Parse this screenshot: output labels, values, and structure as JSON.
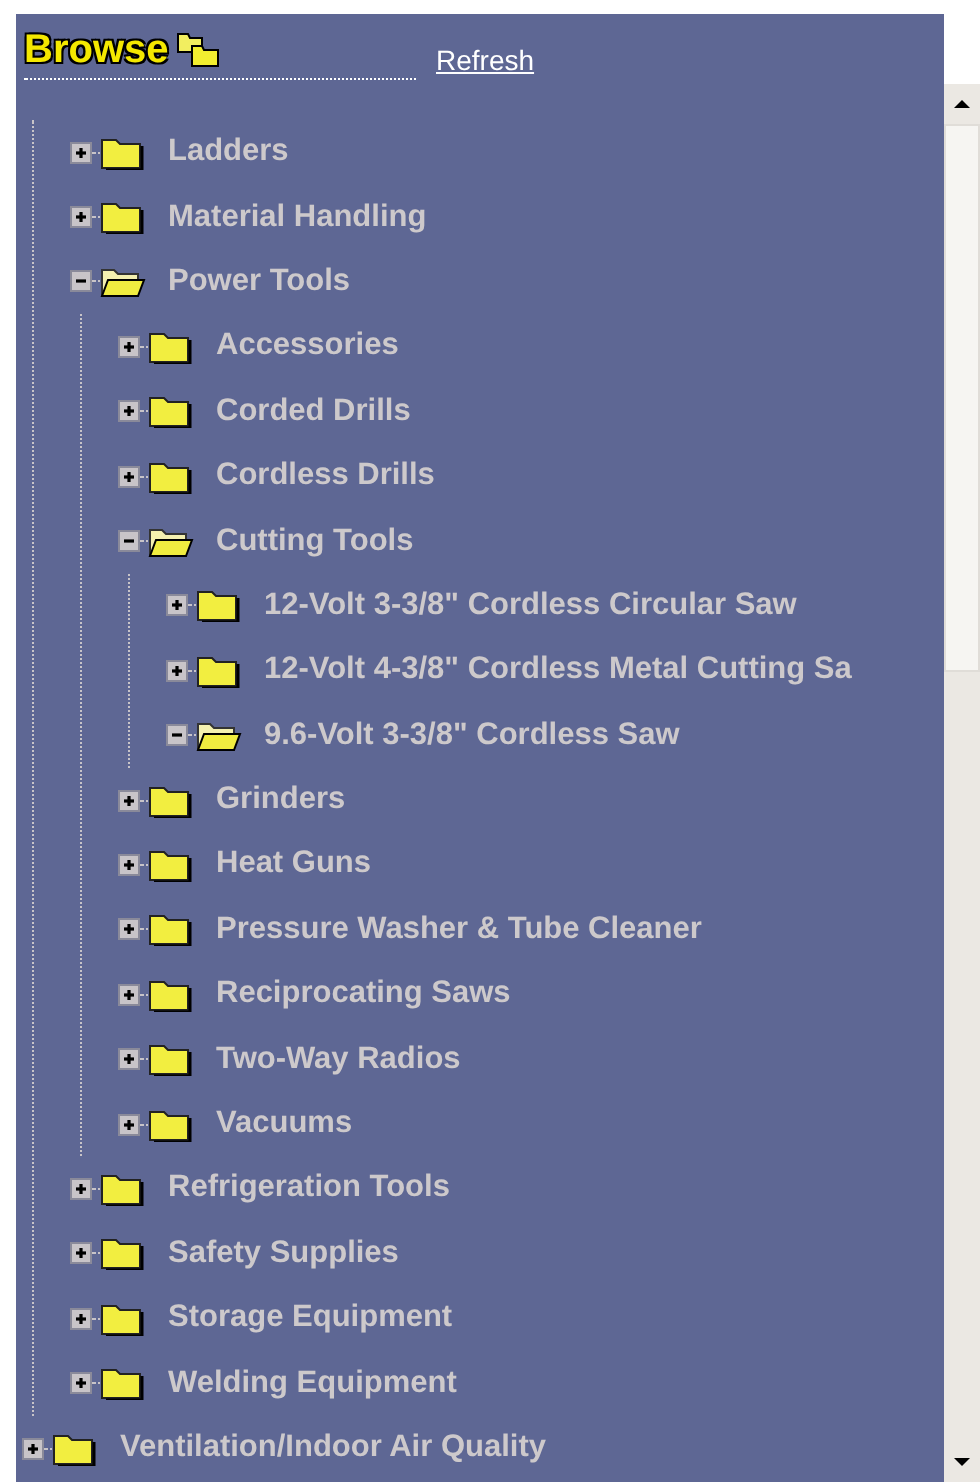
{
  "header": {
    "title": "Browse",
    "refresh_link": "Refresh"
  },
  "tree": {
    "continued_items": [
      {
        "label": "Ladders",
        "expanded": false
      },
      {
        "label": "Material Handling",
        "expanded": false
      },
      {
        "label": "Power Tools",
        "expanded": true,
        "children": [
          {
            "label": "Accessories",
            "expanded": false
          },
          {
            "label": "Corded Drills",
            "expanded": false
          },
          {
            "label": "Cordless Drills",
            "expanded": false
          },
          {
            "label": "Cutting Tools",
            "expanded": true,
            "children": [
              {
                "label": "12-Volt 3-3/8\" Cordless Circular Saw",
                "expanded": false
              },
              {
                "label": "12-Volt 4-3/8\" Cordless Metal Cutting Sa",
                "expanded": false
              },
              {
                "label": "9.6-Volt 3-3/8\" Cordless Saw",
                "expanded": true
              }
            ]
          },
          {
            "label": "Grinders",
            "expanded": false
          },
          {
            "label": "Heat Guns",
            "expanded": false
          },
          {
            "label": "Pressure Washer & Tube Cleaner",
            "expanded": false
          },
          {
            "label": "Reciprocating Saws",
            "expanded": false
          },
          {
            "label": "Two-Way Radios",
            "expanded": false
          },
          {
            "label": "Vacuums",
            "expanded": false
          }
        ]
      },
      {
        "label": "Refrigeration Tools",
        "expanded": false
      },
      {
        "label": "Safety Supplies",
        "expanded": false
      },
      {
        "label": "Storage Equipment",
        "expanded": false
      },
      {
        "label": "Welding Equipment",
        "expanded": false
      }
    ],
    "items": [
      {
        "label": "Ventilation/Indoor Air Quality",
        "expanded": false
      }
    ]
  }
}
